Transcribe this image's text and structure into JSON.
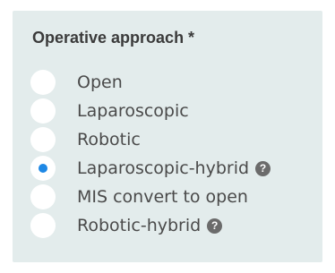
{
  "field": {
    "label": "Operative approach *",
    "selected": "Laparoscopic-hybrid",
    "options": [
      {
        "label": "Open",
        "checked": false,
        "has_help": false
      },
      {
        "label": "Laparoscopic",
        "checked": false,
        "has_help": false
      },
      {
        "label": "Robotic",
        "checked": false,
        "has_help": false
      },
      {
        "label": "Laparoscopic-hybrid",
        "checked": true,
        "has_help": true
      },
      {
        "label": "MIS convert to open",
        "checked": false,
        "has_help": false
      },
      {
        "label": "Robotic-hybrid",
        "checked": false,
        "has_help": true
      }
    ]
  },
  "help_icon": {
    "glyph": "?",
    "name": "help-icon"
  },
  "colors": {
    "panel_background": "#e3ecec",
    "radio_selected": "#1e88e5",
    "help_icon": "#6b6b6b"
  }
}
